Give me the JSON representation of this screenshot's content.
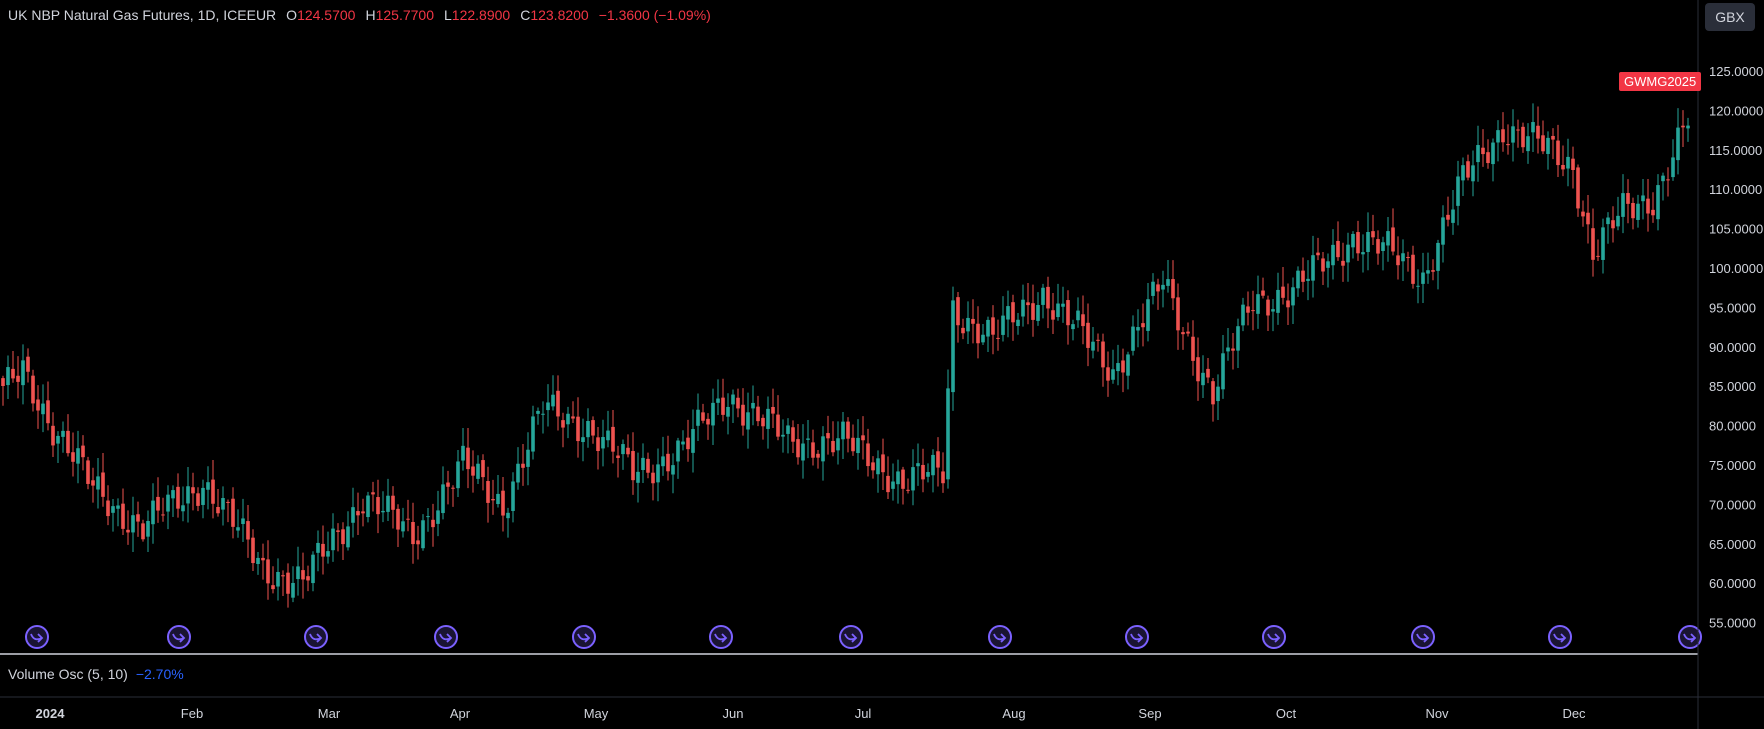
{
  "legend": {
    "symbol": "UK NBP Natural Gas Futures, 1D, ICEEUR",
    "open_label": "O",
    "open": "124.5700",
    "high_label": "H",
    "high": "125.7700",
    "low_label": "L",
    "low": "122.8900",
    "close_label": "C",
    "close": "123.8200",
    "change": "−1.3600 (−1.09%)"
  },
  "currency": "GBX",
  "price_tag": "GWMG2025",
  "oscillator": {
    "name": "Volume Osc (5, 10)",
    "value": "−2.70%"
  },
  "colors": {
    "up": "#26a69a",
    "down": "#ef5350",
    "background": "#000000",
    "event_marker": "#7b61ff",
    "oscillator": "#2962ff"
  },
  "chart_data": {
    "type": "candlestick",
    "y_axis": {
      "min": 55,
      "max": 125,
      "step": 5,
      "ticks": [
        "125.0000",
        "120.0000",
        "115.0000",
        "110.0000",
        "105.0000",
        "100.0000",
        "95.0000",
        "90.0000",
        "85.0000",
        "80.0000",
        "75.0000",
        "70.0000",
        "65.0000",
        "60.0000",
        "55.0000"
      ]
    },
    "x_axis": {
      "labels": [
        "2024",
        "Feb",
        "Mar",
        "Apr",
        "May",
        "Jun",
        "Jul",
        "Aug",
        "Sep",
        "Oct",
        "Nov",
        "Dec"
      ]
    },
    "event_markers": 13,
    "waypoints": [
      [
        0,
        84
      ],
      [
        4,
        87
      ],
      [
        10,
        80
      ],
      [
        18,
        72
      ],
      [
        28,
        67
      ],
      [
        40,
        73
      ],
      [
        52,
        62
      ],
      [
        60,
        60
      ],
      [
        72,
        71
      ],
      [
        82,
        66
      ],
      [
        92,
        75
      ],
      [
        100,
        70
      ],
      [
        108,
        82
      ],
      [
        117,
        80
      ],
      [
        126,
        74
      ],
      [
        136,
        77
      ],
      [
        145,
        84
      ],
      [
        157,
        78
      ],
      [
        168,
        78
      ],
      [
        180,
        73
      ],
      [
        188,
        74
      ],
      [
        190,
        95
      ],
      [
        198,
        91
      ],
      [
        208,
        97
      ],
      [
        222,
        87
      ],
      [
        232,
        98
      ],
      [
        242,
        84
      ],
      [
        250,
        96
      ],
      [
        258,
        97
      ],
      [
        270,
        104
      ],
      [
        277,
        102
      ],
      [
        284,
        99
      ],
      [
        292,
        111
      ],
      [
        300,
        118
      ],
      [
        306,
        116
      ],
      [
        314,
        113
      ],
      [
        318,
        102
      ],
      [
        324,
        107
      ],
      [
        330,
        109
      ],
      [
        338,
        120
      ]
    ],
    "last_candle": {
      "open": 124.57,
      "high": 125.77,
      "low": 122.89,
      "close": 123.82
    }
  }
}
